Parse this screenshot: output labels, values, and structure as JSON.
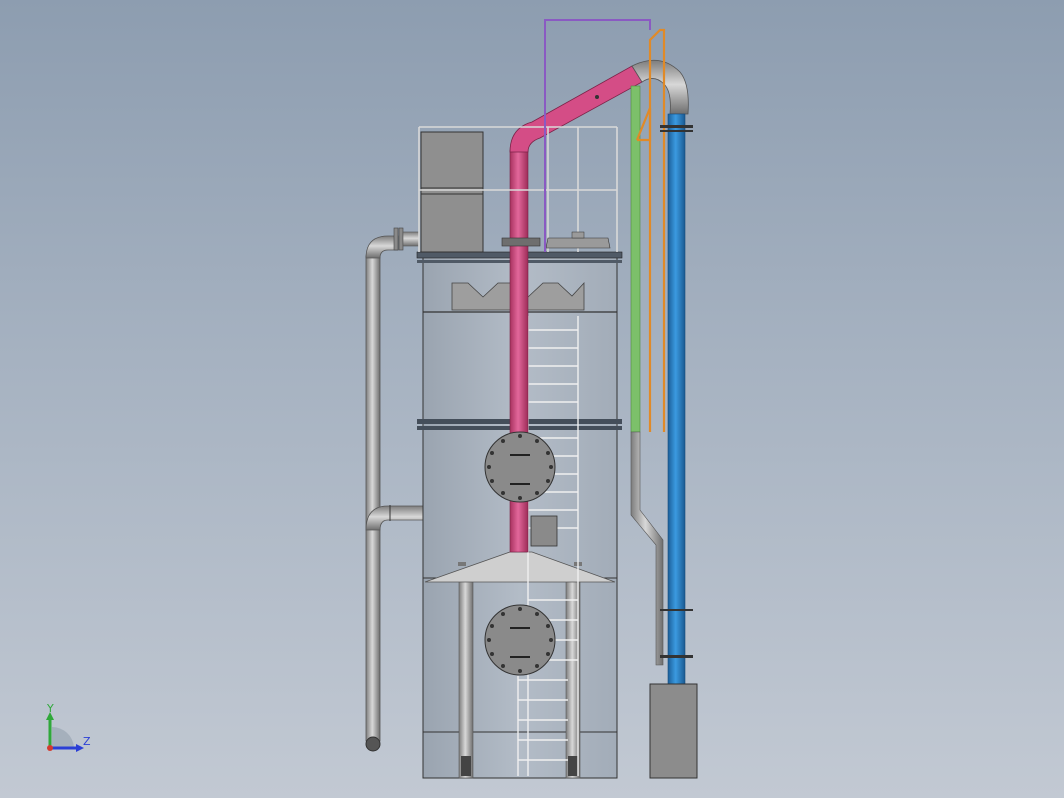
{
  "triad": {
    "y_label": "Y",
    "z_label": "Z"
  },
  "colors": {
    "background_top": "#8d9db0",
    "background_bottom": "#c2c9d3",
    "tower_body": "#a9b3bf",
    "steel": "#8c8c8c",
    "pipe_magenta": "#d64b86",
    "pipe_blue": "#2a88cf",
    "pipe_green": "#7cc06a",
    "pipe_orange": "#e08a28",
    "pipe_purple": "#8a5ac2",
    "hood": "#cfcfcf",
    "triad_y": "#2fa83a",
    "triad_z": "#2b3fd6",
    "triad_x": "#d43a2f"
  }
}
